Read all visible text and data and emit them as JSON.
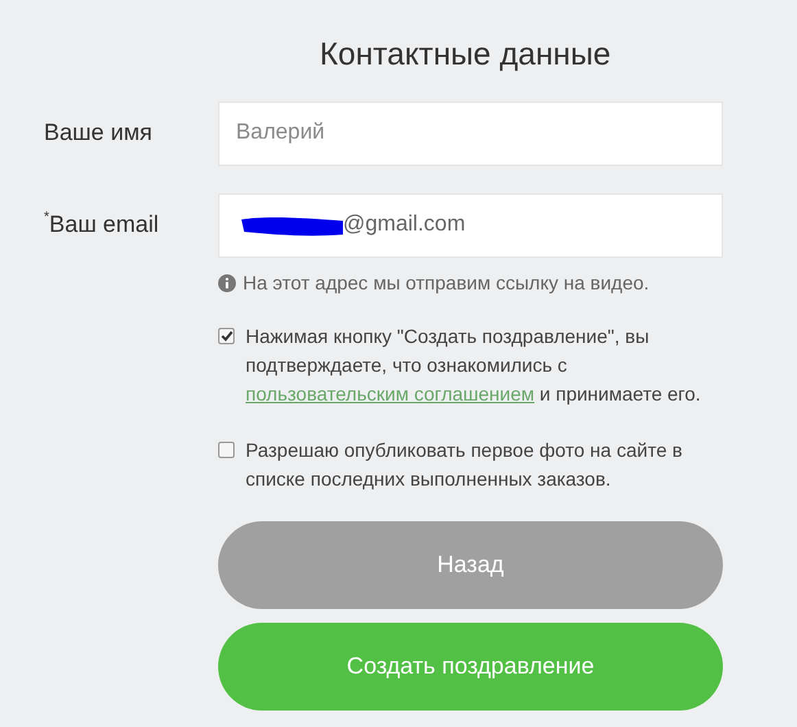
{
  "title": "Контактные данные",
  "name_field": {
    "label": "Ваше имя",
    "placeholder": "Валерий"
  },
  "email_field": {
    "required_mark": "*",
    "label": "Ваш email",
    "value": "@gmail.com",
    "redacted": true
  },
  "hint": "На этот адрес мы отправим ссылку на видео.",
  "checkboxes": [
    {
      "checked": true,
      "text_before": "Нажимая кнопку \"Создать поздравление\", вы подтверждаете, что ознакомились с ",
      "link": "пользовательским соглашением",
      "text_after": " и принимаете его."
    },
    {
      "checked": false,
      "text_before": "Разрешаю опубликовать первое фото на сайте в списке последних выполненных заказов."
    }
  ],
  "buttons": [
    {
      "label": "Назад",
      "kind": "secondary"
    },
    {
      "label": "Создать поздравление",
      "kind": "primary"
    }
  ]
}
